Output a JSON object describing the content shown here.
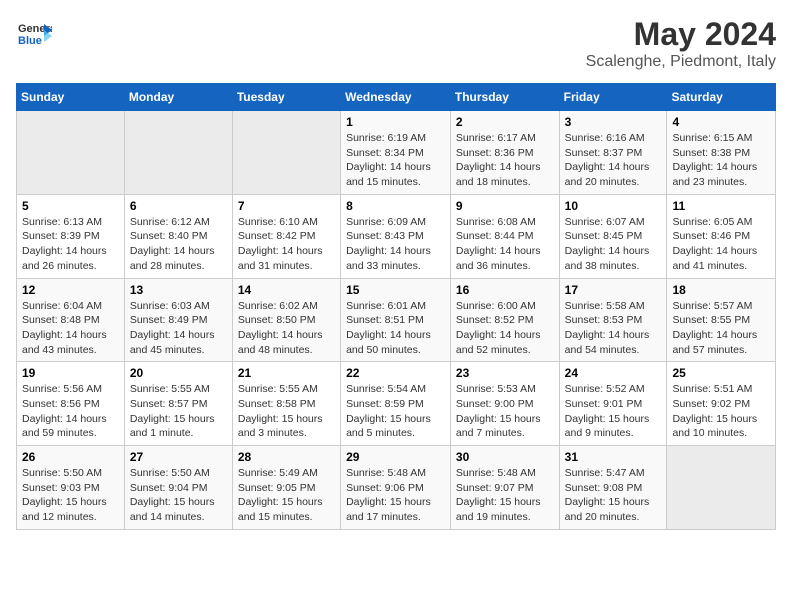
{
  "header": {
    "logo_general": "General",
    "logo_blue": "Blue",
    "title": "May 2024",
    "subtitle": "Scalenghe, Piedmont, Italy"
  },
  "days_of_week": [
    "Sunday",
    "Monday",
    "Tuesday",
    "Wednesday",
    "Thursday",
    "Friday",
    "Saturday"
  ],
  "weeks": [
    [
      {
        "day": "",
        "empty": true
      },
      {
        "day": "",
        "empty": true
      },
      {
        "day": "",
        "empty": true
      },
      {
        "day": "1",
        "sunrise": "Sunrise: 6:19 AM",
        "sunset": "Sunset: 8:34 PM",
        "daylight": "Daylight: 14 hours and 15 minutes."
      },
      {
        "day": "2",
        "sunrise": "Sunrise: 6:17 AM",
        "sunset": "Sunset: 8:36 PM",
        "daylight": "Daylight: 14 hours and 18 minutes."
      },
      {
        "day": "3",
        "sunrise": "Sunrise: 6:16 AM",
        "sunset": "Sunset: 8:37 PM",
        "daylight": "Daylight: 14 hours and 20 minutes."
      },
      {
        "day": "4",
        "sunrise": "Sunrise: 6:15 AM",
        "sunset": "Sunset: 8:38 PM",
        "daylight": "Daylight: 14 hours and 23 minutes."
      }
    ],
    [
      {
        "day": "5",
        "sunrise": "Sunrise: 6:13 AM",
        "sunset": "Sunset: 8:39 PM",
        "daylight": "Daylight: 14 hours and 26 minutes."
      },
      {
        "day": "6",
        "sunrise": "Sunrise: 6:12 AM",
        "sunset": "Sunset: 8:40 PM",
        "daylight": "Daylight: 14 hours and 28 minutes."
      },
      {
        "day": "7",
        "sunrise": "Sunrise: 6:10 AM",
        "sunset": "Sunset: 8:42 PM",
        "daylight": "Daylight: 14 hours and 31 minutes."
      },
      {
        "day": "8",
        "sunrise": "Sunrise: 6:09 AM",
        "sunset": "Sunset: 8:43 PM",
        "daylight": "Daylight: 14 hours and 33 minutes."
      },
      {
        "day": "9",
        "sunrise": "Sunrise: 6:08 AM",
        "sunset": "Sunset: 8:44 PM",
        "daylight": "Daylight: 14 hours and 36 minutes."
      },
      {
        "day": "10",
        "sunrise": "Sunrise: 6:07 AM",
        "sunset": "Sunset: 8:45 PM",
        "daylight": "Daylight: 14 hours and 38 minutes."
      },
      {
        "day": "11",
        "sunrise": "Sunrise: 6:05 AM",
        "sunset": "Sunset: 8:46 PM",
        "daylight": "Daylight: 14 hours and 41 minutes."
      }
    ],
    [
      {
        "day": "12",
        "sunrise": "Sunrise: 6:04 AM",
        "sunset": "Sunset: 8:48 PM",
        "daylight": "Daylight: 14 hours and 43 minutes."
      },
      {
        "day": "13",
        "sunrise": "Sunrise: 6:03 AM",
        "sunset": "Sunset: 8:49 PM",
        "daylight": "Daylight: 14 hours and 45 minutes."
      },
      {
        "day": "14",
        "sunrise": "Sunrise: 6:02 AM",
        "sunset": "Sunset: 8:50 PM",
        "daylight": "Daylight: 14 hours and 48 minutes."
      },
      {
        "day": "15",
        "sunrise": "Sunrise: 6:01 AM",
        "sunset": "Sunset: 8:51 PM",
        "daylight": "Daylight: 14 hours and 50 minutes."
      },
      {
        "day": "16",
        "sunrise": "Sunrise: 6:00 AM",
        "sunset": "Sunset: 8:52 PM",
        "daylight": "Daylight: 14 hours and 52 minutes."
      },
      {
        "day": "17",
        "sunrise": "Sunrise: 5:58 AM",
        "sunset": "Sunset: 8:53 PM",
        "daylight": "Daylight: 14 hours and 54 minutes."
      },
      {
        "day": "18",
        "sunrise": "Sunrise: 5:57 AM",
        "sunset": "Sunset: 8:55 PM",
        "daylight": "Daylight: 14 hours and 57 minutes."
      }
    ],
    [
      {
        "day": "19",
        "sunrise": "Sunrise: 5:56 AM",
        "sunset": "Sunset: 8:56 PM",
        "daylight": "Daylight: 14 hours and 59 minutes."
      },
      {
        "day": "20",
        "sunrise": "Sunrise: 5:55 AM",
        "sunset": "Sunset: 8:57 PM",
        "daylight": "Daylight: 15 hours and 1 minute."
      },
      {
        "day": "21",
        "sunrise": "Sunrise: 5:55 AM",
        "sunset": "Sunset: 8:58 PM",
        "daylight": "Daylight: 15 hours and 3 minutes."
      },
      {
        "day": "22",
        "sunrise": "Sunrise: 5:54 AM",
        "sunset": "Sunset: 8:59 PM",
        "daylight": "Daylight: 15 hours and 5 minutes."
      },
      {
        "day": "23",
        "sunrise": "Sunrise: 5:53 AM",
        "sunset": "Sunset: 9:00 PM",
        "daylight": "Daylight: 15 hours and 7 minutes."
      },
      {
        "day": "24",
        "sunrise": "Sunrise: 5:52 AM",
        "sunset": "Sunset: 9:01 PM",
        "daylight": "Daylight: 15 hours and 9 minutes."
      },
      {
        "day": "25",
        "sunrise": "Sunrise: 5:51 AM",
        "sunset": "Sunset: 9:02 PM",
        "daylight": "Daylight: 15 hours and 10 minutes."
      }
    ],
    [
      {
        "day": "26",
        "sunrise": "Sunrise: 5:50 AM",
        "sunset": "Sunset: 9:03 PM",
        "daylight": "Daylight: 15 hours and 12 minutes."
      },
      {
        "day": "27",
        "sunrise": "Sunrise: 5:50 AM",
        "sunset": "Sunset: 9:04 PM",
        "daylight": "Daylight: 15 hours and 14 minutes."
      },
      {
        "day": "28",
        "sunrise": "Sunrise: 5:49 AM",
        "sunset": "Sunset: 9:05 PM",
        "daylight": "Daylight: 15 hours and 15 minutes."
      },
      {
        "day": "29",
        "sunrise": "Sunrise: 5:48 AM",
        "sunset": "Sunset: 9:06 PM",
        "daylight": "Daylight: 15 hours and 17 minutes."
      },
      {
        "day": "30",
        "sunrise": "Sunrise: 5:48 AM",
        "sunset": "Sunset: 9:07 PM",
        "daylight": "Daylight: 15 hours and 19 minutes."
      },
      {
        "day": "31",
        "sunrise": "Sunrise: 5:47 AM",
        "sunset": "Sunset: 9:08 PM",
        "daylight": "Daylight: 15 hours and 20 minutes."
      },
      {
        "day": "",
        "empty": true
      }
    ]
  ]
}
